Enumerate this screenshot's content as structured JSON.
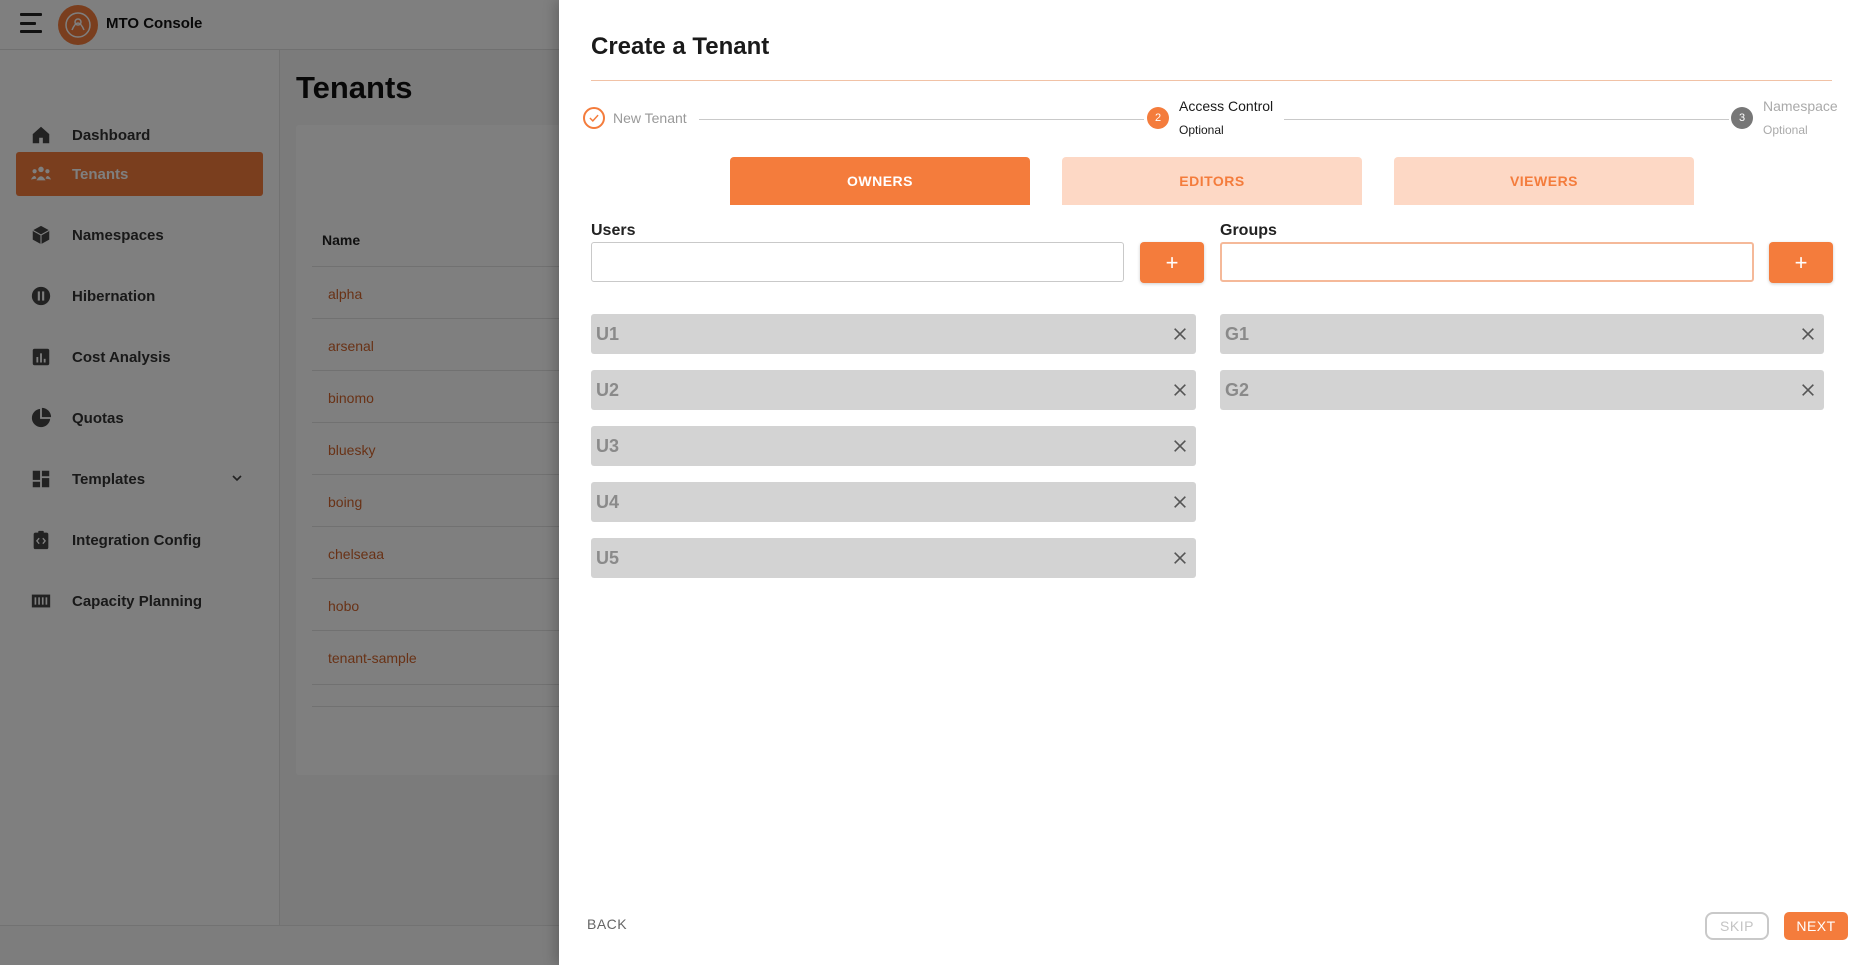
{
  "app": {
    "title": "MTO Console"
  },
  "sidebar": {
    "items": [
      {
        "label": "Dashboard",
        "icon": "home-icon"
      },
      {
        "label": "Tenants",
        "icon": "group-icon",
        "active": true
      },
      {
        "label": "Namespaces",
        "icon": "cube-icon"
      },
      {
        "label": "Hibernation",
        "icon": "pause-circle-icon"
      },
      {
        "label": "Cost Analysis",
        "icon": "bar-chart-icon"
      },
      {
        "label": "Quotas",
        "icon": "pie-chart-icon"
      },
      {
        "label": "Templates",
        "icon": "dashboard-grid-icon",
        "expandable": true
      },
      {
        "label": "Integration Config",
        "icon": "code-clipboard-icon"
      },
      {
        "label": "Capacity Planning",
        "icon": "capacity-bars-icon"
      }
    ]
  },
  "content": {
    "title": "Tenants",
    "table": {
      "column_name": "Name",
      "rows": [
        "alpha",
        "arsenal",
        "binomo",
        "bluesky",
        "boing",
        "chelseaa",
        "hobo",
        "tenant-sample"
      ]
    }
  },
  "drawer": {
    "title": "Create a Tenant",
    "steps": [
      {
        "number": "1",
        "label": "New Tenant",
        "status": "completed"
      },
      {
        "number": "2",
        "label": "Access Control",
        "sub": "Optional",
        "status": "active"
      },
      {
        "number": "3",
        "label": "Namespace",
        "sub": "Optional",
        "status": "pending"
      }
    ],
    "tabs": [
      {
        "label": "OWNERS",
        "active": true
      },
      {
        "label": "EDITORS",
        "active": false
      },
      {
        "label": "VIEWERS",
        "active": false
      }
    ],
    "users": {
      "label": "Users",
      "value": "",
      "add_label": "+",
      "items": [
        "U1",
        "U2",
        "U3",
        "U4",
        "U5"
      ]
    },
    "groups": {
      "label": "Groups",
      "value": "",
      "add_label": "+",
      "items": [
        "G1",
        "G2"
      ]
    },
    "footer": {
      "back": "BACK",
      "skip": "SKIP",
      "next": "NEXT"
    }
  },
  "colors": {
    "accent": "#f47c3c",
    "accent_light": "#fdd8c5",
    "chip_bg": "#d3d3d3",
    "link": "#d2652d"
  }
}
